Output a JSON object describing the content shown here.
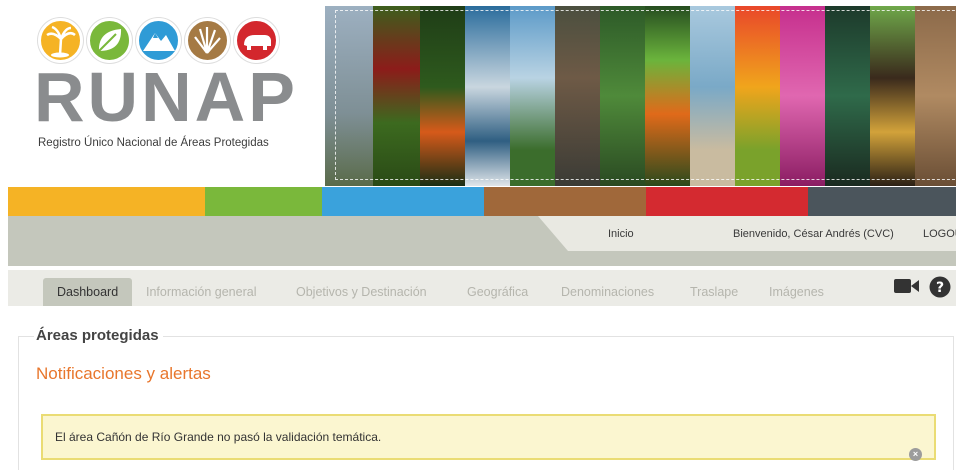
{
  "logo": {
    "wordmark": "RUNAP",
    "subtitle": "Registro Único Nacional de Áreas Protegidas",
    "circle_colors": [
      "#f5b325",
      "#7ab83b",
      "#2f9bd6",
      "#a57a44",
      "#d3272d"
    ],
    "circle_icons": [
      "palm-tree-icon",
      "leaf-icon",
      "mountain-icon",
      "grass-icon",
      "bear-icon"
    ]
  },
  "color_bar": [
    "#f5b325",
    "#7ab83b",
    "#3aa2dc",
    "#a0683a",
    "#d42a30",
    "#4b555c"
  ],
  "userbar": {
    "home": "Inicio",
    "welcome": "Bienvenido, César Andrés (CVC)",
    "logout": "LOGOU"
  },
  "tabs": [
    {
      "label": "Dashboard",
      "active": true
    },
    {
      "label": "Información general",
      "active": false
    },
    {
      "label": "Objetivos y Destinación",
      "active": false
    },
    {
      "label": "Geográfica",
      "active": false
    },
    {
      "label": "Denominaciones",
      "active": false
    },
    {
      "label": "Traslape",
      "active": false
    },
    {
      "label": "Imágenes",
      "active": false
    }
  ],
  "tab_icons": [
    "video-camera-icon",
    "help-icon"
  ],
  "section": {
    "legend": "Áreas protegidas",
    "notifications_title": "Notificaciones y alertas"
  },
  "alert": {
    "message": "El área Cañón de Río Grande no pasó la validación temática.",
    "close_glyph": "×"
  },
  "colors": {
    "accent_orange": "#e8762c",
    "alert_bg": "#fbf6d0",
    "alert_border": "#eadc74",
    "tab_active_bg": "#c4c7bc"
  }
}
